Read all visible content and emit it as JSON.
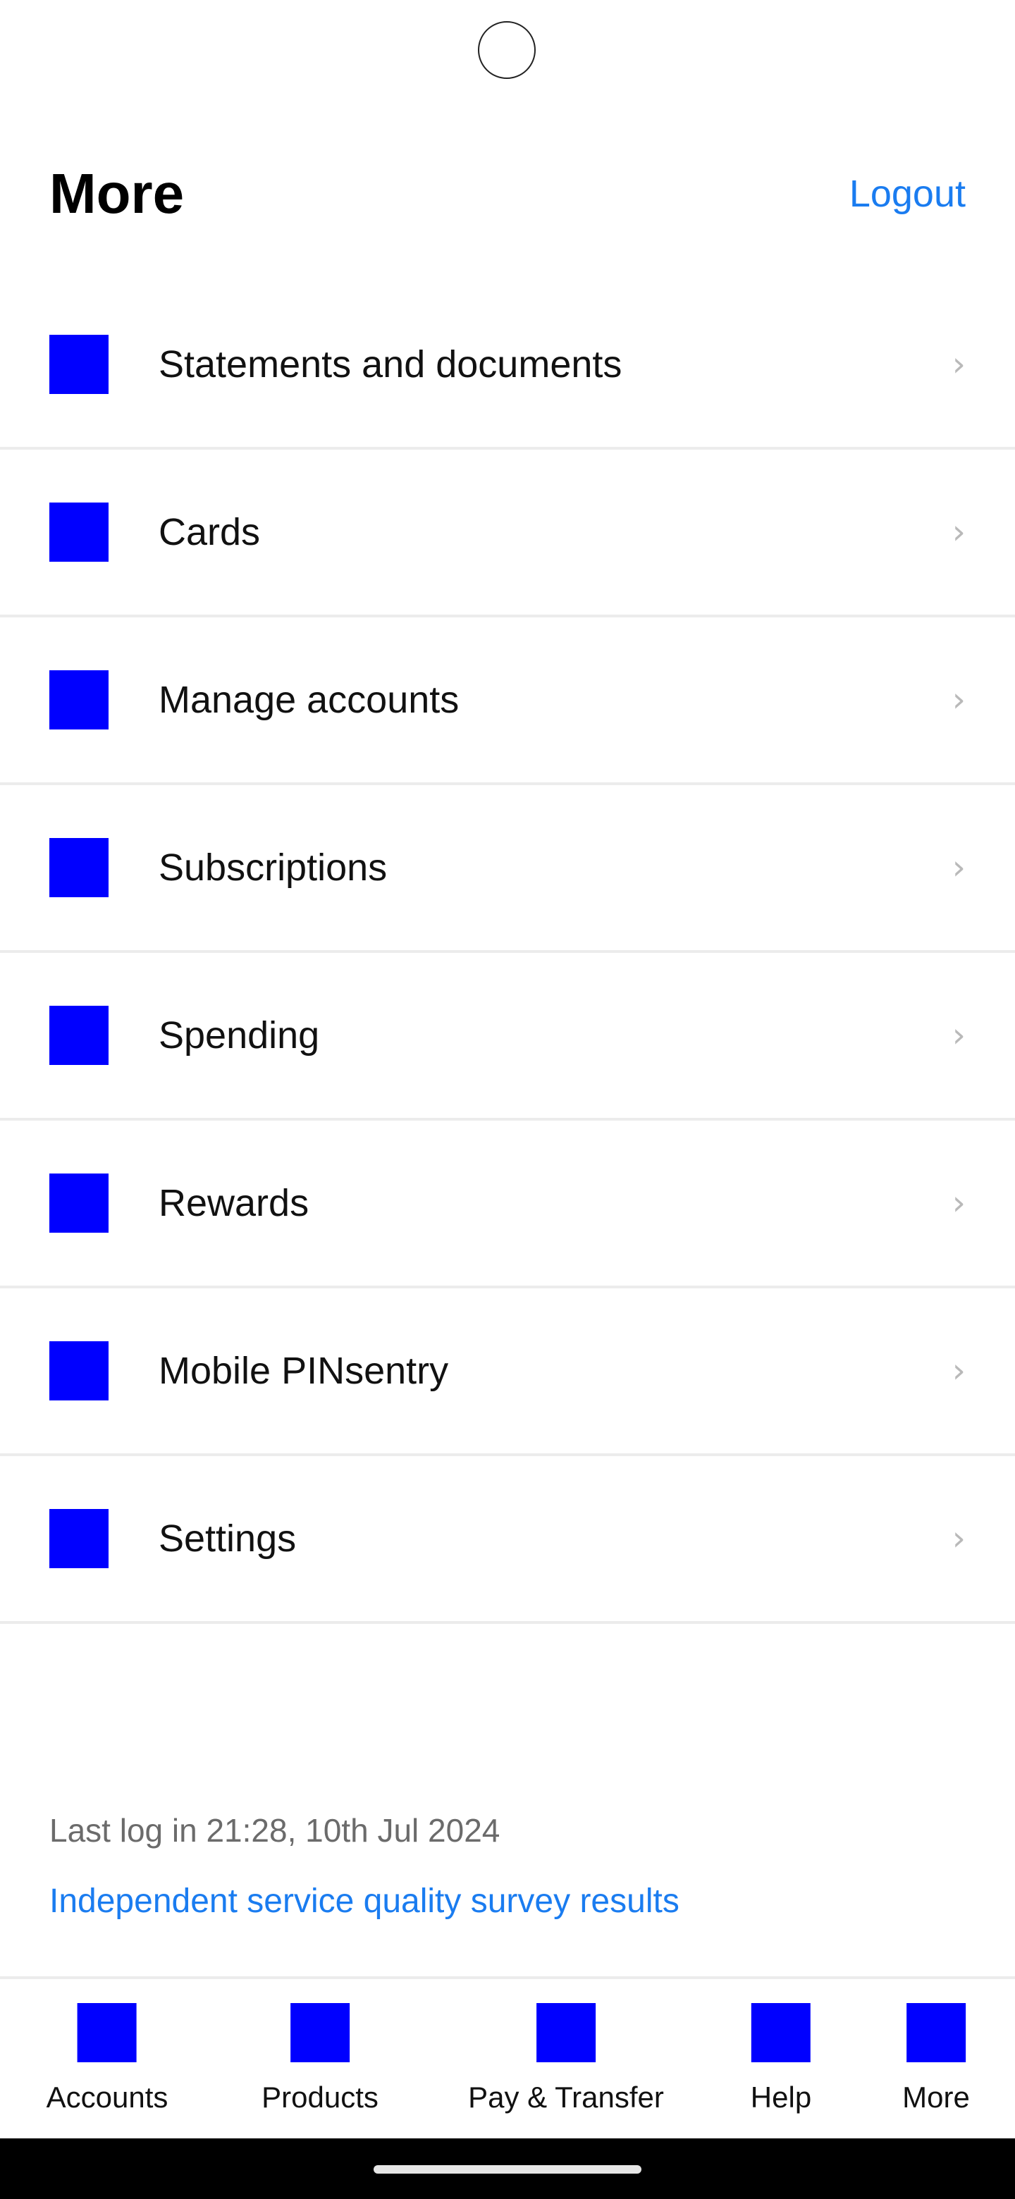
{
  "header": {
    "title": "More",
    "logout_label": "Logout"
  },
  "menu": {
    "items": [
      {
        "label": "Statements and documents"
      },
      {
        "label": "Cards"
      },
      {
        "label": "Manage accounts"
      },
      {
        "label": "Subscriptions"
      },
      {
        "label": "Spending"
      },
      {
        "label": "Rewards"
      },
      {
        "label": "Mobile PINsentry"
      },
      {
        "label": "Settings"
      }
    ],
    "chevron": "›"
  },
  "footer": {
    "last_login": "Last log in 21:28, 10th Jul 2024",
    "survey_link": "Independent service quality survey results"
  },
  "bottom_nav": {
    "items": [
      {
        "label": "Accounts"
      },
      {
        "label": "Products"
      },
      {
        "label": "Pay & Transfer"
      },
      {
        "label": "Help"
      },
      {
        "label": "More"
      }
    ]
  },
  "colors": {
    "accent": "#1a7cf0",
    "icon_placeholder": "#0000ff"
  }
}
